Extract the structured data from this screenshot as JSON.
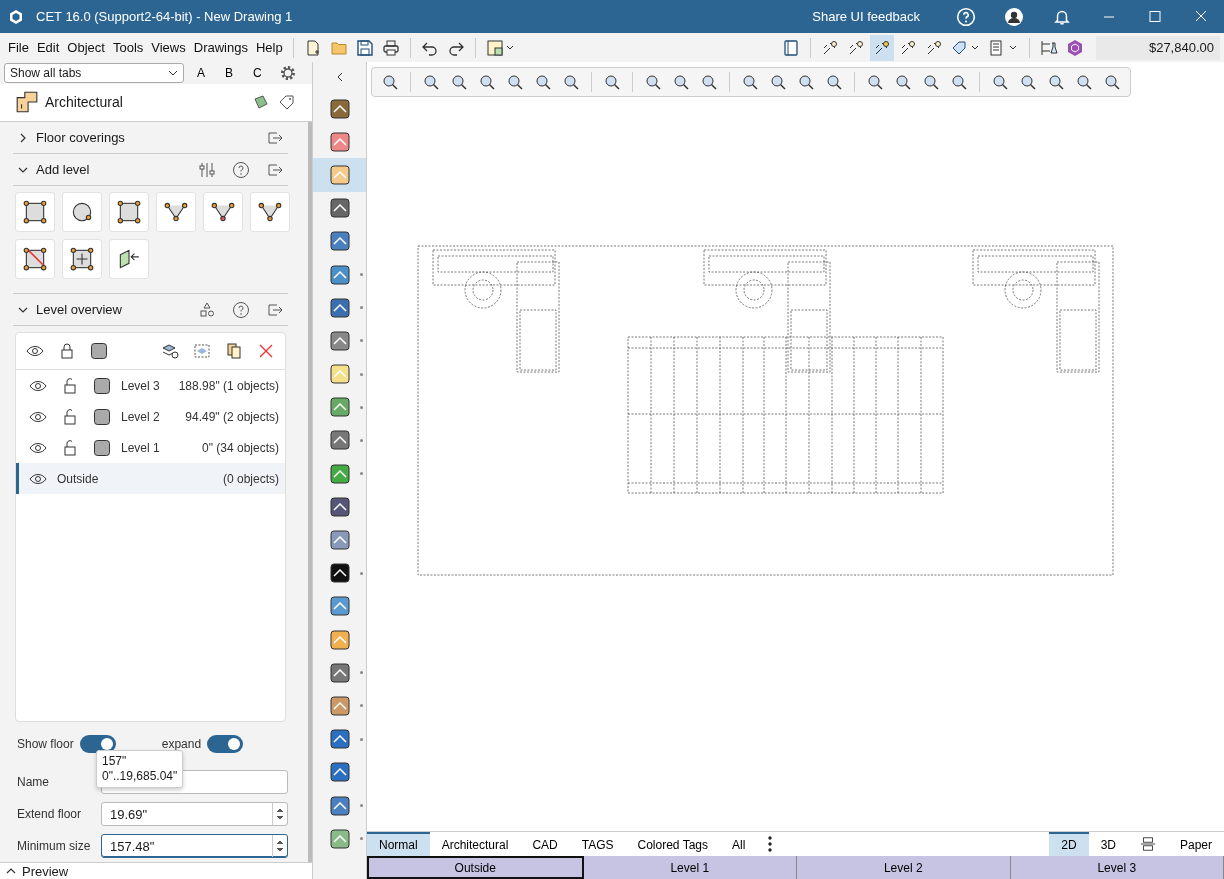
{
  "window": {
    "title": "CET 16.0 (Support2-64-bit) - New Drawing 1",
    "feedback": "Share UI feedback"
  },
  "menu": [
    "File",
    "Edit",
    "Object",
    "Tools",
    "Views",
    "Drawings",
    "Help"
  ],
  "tool_toggles": [
    {
      "selected": false
    },
    {
      "selected": false
    },
    {
      "selected": true
    },
    {
      "selected": false
    },
    {
      "selected": false
    }
  ],
  "price": "$27,840.00",
  "tab_filter": {
    "value": "Show all tabs"
  },
  "filter_letters": [
    "A",
    "B",
    "C"
  ],
  "panel": {
    "title": "Architectural"
  },
  "sections": [
    {
      "title": "Floor coverings",
      "expanded": false
    },
    {
      "title": "Add level",
      "expanded": true
    },
    {
      "title": "Level overview",
      "expanded": true
    }
  ],
  "levels": [
    {
      "kind": "level",
      "name": "Level 3",
      "info": "188.98\" (1 objects)",
      "selected": false
    },
    {
      "kind": "level",
      "name": "Level 2",
      "info": "94.49\" (2 objects)",
      "selected": false
    },
    {
      "kind": "level",
      "name": "Level 1",
      "info": "0\" (34 objects)",
      "selected": false
    },
    {
      "kind": "outside",
      "name": "Outside",
      "info": "(0 objects)",
      "selected": true
    }
  ],
  "toggles": [
    {
      "label": "Show floor",
      "on": true
    },
    {
      "label": "expand",
      "on": true
    }
  ],
  "fields": [
    {
      "label": "Name",
      "focused": false
    },
    {
      "label": "Extend floor",
      "value": "19.69\"",
      "focused": false
    },
    {
      "label": "Minimum size",
      "value": "157.48\"",
      "focused": true
    }
  ],
  "tooltip": [
    "157\"",
    "0\"..19,685.04\""
  ],
  "preview": {
    "label": "Preview",
    "expanded": false
  },
  "categories": [
    {
      "selected": false,
      "more": false
    },
    {
      "selected": false,
      "more": false
    },
    {
      "selected": true,
      "more": false
    },
    {
      "selected": false,
      "more": false
    },
    {
      "selected": false,
      "more": false
    },
    {
      "selected": false,
      "more": true
    },
    {
      "selected": false,
      "more": true
    },
    {
      "selected": false,
      "more": true
    },
    {
      "selected": false,
      "more": true
    },
    {
      "selected": false,
      "more": true
    },
    {
      "selected": false,
      "more": true
    },
    {
      "selected": false,
      "more": true
    },
    {
      "selected": false,
      "more": false
    },
    {
      "selected": false,
      "more": false
    },
    {
      "selected": false,
      "more": true
    },
    {
      "selected": false,
      "more": false
    },
    {
      "selected": false,
      "more": false
    },
    {
      "selected": false,
      "more": true
    },
    {
      "selected": false,
      "more": true
    },
    {
      "selected": false,
      "more": true
    },
    {
      "selected": false,
      "more": false
    },
    {
      "selected": false,
      "more": true
    },
    {
      "selected": false,
      "more": true
    }
  ],
  "view_tabs": [
    {
      "label": "Normal",
      "selected": true
    },
    {
      "label": "Architectural",
      "selected": false
    },
    {
      "label": "CAD",
      "selected": false
    },
    {
      "label": "TAGS",
      "selected": false
    },
    {
      "label": "Colored Tags",
      "selected": false
    },
    {
      "label": "All",
      "selected": false
    }
  ],
  "view_modes": [
    {
      "kind": "text",
      "label": "2D",
      "selected": true
    },
    {
      "kind": "text",
      "label": "3D",
      "selected": false
    },
    {
      "kind": "split",
      "selected": false
    },
    {
      "kind": "text",
      "label": "Paper",
      "selected": false
    }
  ],
  "level_tabs": [
    {
      "label": "Outside",
      "selected": true
    },
    {
      "label": "Level 1",
      "selected": false
    },
    {
      "label": "Level 2",
      "selected": false
    },
    {
      "label": "Level 3",
      "selected": false
    }
  ]
}
